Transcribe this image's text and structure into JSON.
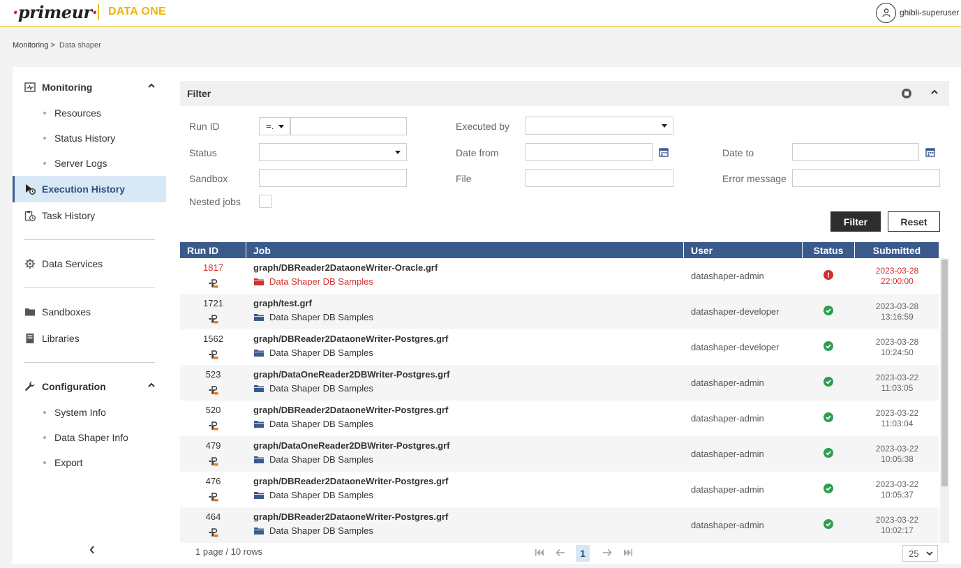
{
  "header": {
    "logo_text": "primeur",
    "product": "DATA ONE",
    "user": "ghibli-superuser"
  },
  "breadcrumb": {
    "parent": "Monitoring >",
    "current": "Data shaper"
  },
  "sidebar": {
    "monitoring": "Monitoring",
    "resources": "Resources",
    "status_history": "Status History",
    "server_logs": "Server Logs",
    "execution_history": "Execution History",
    "task_history": "Task History",
    "data_services": "Data Services",
    "sandboxes": "Sandboxes",
    "libraries": "Libraries",
    "configuration": "Configuration",
    "system_info": "System Info",
    "data_shaper_info": "Data Shaper Info",
    "export": "Export"
  },
  "filter": {
    "title": "Filter",
    "run_id_label": "Run ID",
    "run_id_operator": "=.",
    "executed_by_label": "Executed by",
    "status_label": "Status",
    "date_from_label": "Date from",
    "date_to_label": "Date to",
    "sandbox_label": "Sandbox",
    "file_label": "File",
    "error_message_label": "Error message",
    "nested_jobs_label": "Nested jobs",
    "filter_button": "Filter",
    "reset_button": "Reset"
  },
  "table": {
    "columns": [
      "Run ID",
      "Job",
      "User",
      "Status",
      "Submitted"
    ],
    "rows": [
      {
        "run_id": "1817",
        "job": "graph/DBReader2DataoneWriter-Oracle.grf",
        "sandbox": "Data Shaper DB Samples",
        "user": "datashaper-admin",
        "status": "error",
        "date": "2023-03-28",
        "time": "22:00:00"
      },
      {
        "run_id": "1721",
        "job": "graph/test.grf",
        "sandbox": "Data Shaper DB Samples",
        "user": "datashaper-developer",
        "status": "ok",
        "date": "2023-03-28",
        "time": "13:16:59"
      },
      {
        "run_id": "1562",
        "job": "graph/DBReader2DataoneWriter-Postgres.grf",
        "sandbox": "Data Shaper DB Samples",
        "user": "datashaper-developer",
        "status": "ok",
        "date": "2023-03-28",
        "time": "10:24:50"
      },
      {
        "run_id": "523",
        "job": "graph/DataOneReader2DBWriter-Postgres.grf",
        "sandbox": "Data Shaper DB Samples",
        "user": "datashaper-admin",
        "status": "ok",
        "date": "2023-03-22",
        "time": "11:03:05"
      },
      {
        "run_id": "520",
        "job": "graph/DBReader2DataoneWriter-Postgres.grf",
        "sandbox": "Data Shaper DB Samples",
        "user": "datashaper-admin",
        "status": "ok",
        "date": "2023-03-22",
        "time": "11:03:04"
      },
      {
        "run_id": "479",
        "job": "graph/DataOneReader2DBWriter-Postgres.grf",
        "sandbox": "Data Shaper DB Samples",
        "user": "datashaper-admin",
        "status": "ok",
        "date": "2023-03-22",
        "time": "10:05:38"
      },
      {
        "run_id": "476",
        "job": "graph/DBReader2DataoneWriter-Postgres.grf",
        "sandbox": "Data Shaper DB Samples",
        "user": "datashaper-admin",
        "status": "ok",
        "date": "2023-03-22",
        "time": "10:05:37"
      },
      {
        "run_id": "464",
        "job": "graph/DBReader2DataoneWriter-Postgres.grf",
        "sandbox": "Data Shaper DB Samples",
        "user": "datashaper-admin",
        "status": "ok",
        "date": "2023-03-22",
        "time": "10:02:17"
      }
    ]
  },
  "pagination": {
    "info": "1 page / 10 rows",
    "current_page": "1",
    "page_size": "25"
  },
  "colors": {
    "accent": "#f0b400",
    "table_header": "#3a5a8c",
    "error": "#d32f2f",
    "success": "#2e9e4f",
    "folder_blue": "#3a5a8c"
  }
}
